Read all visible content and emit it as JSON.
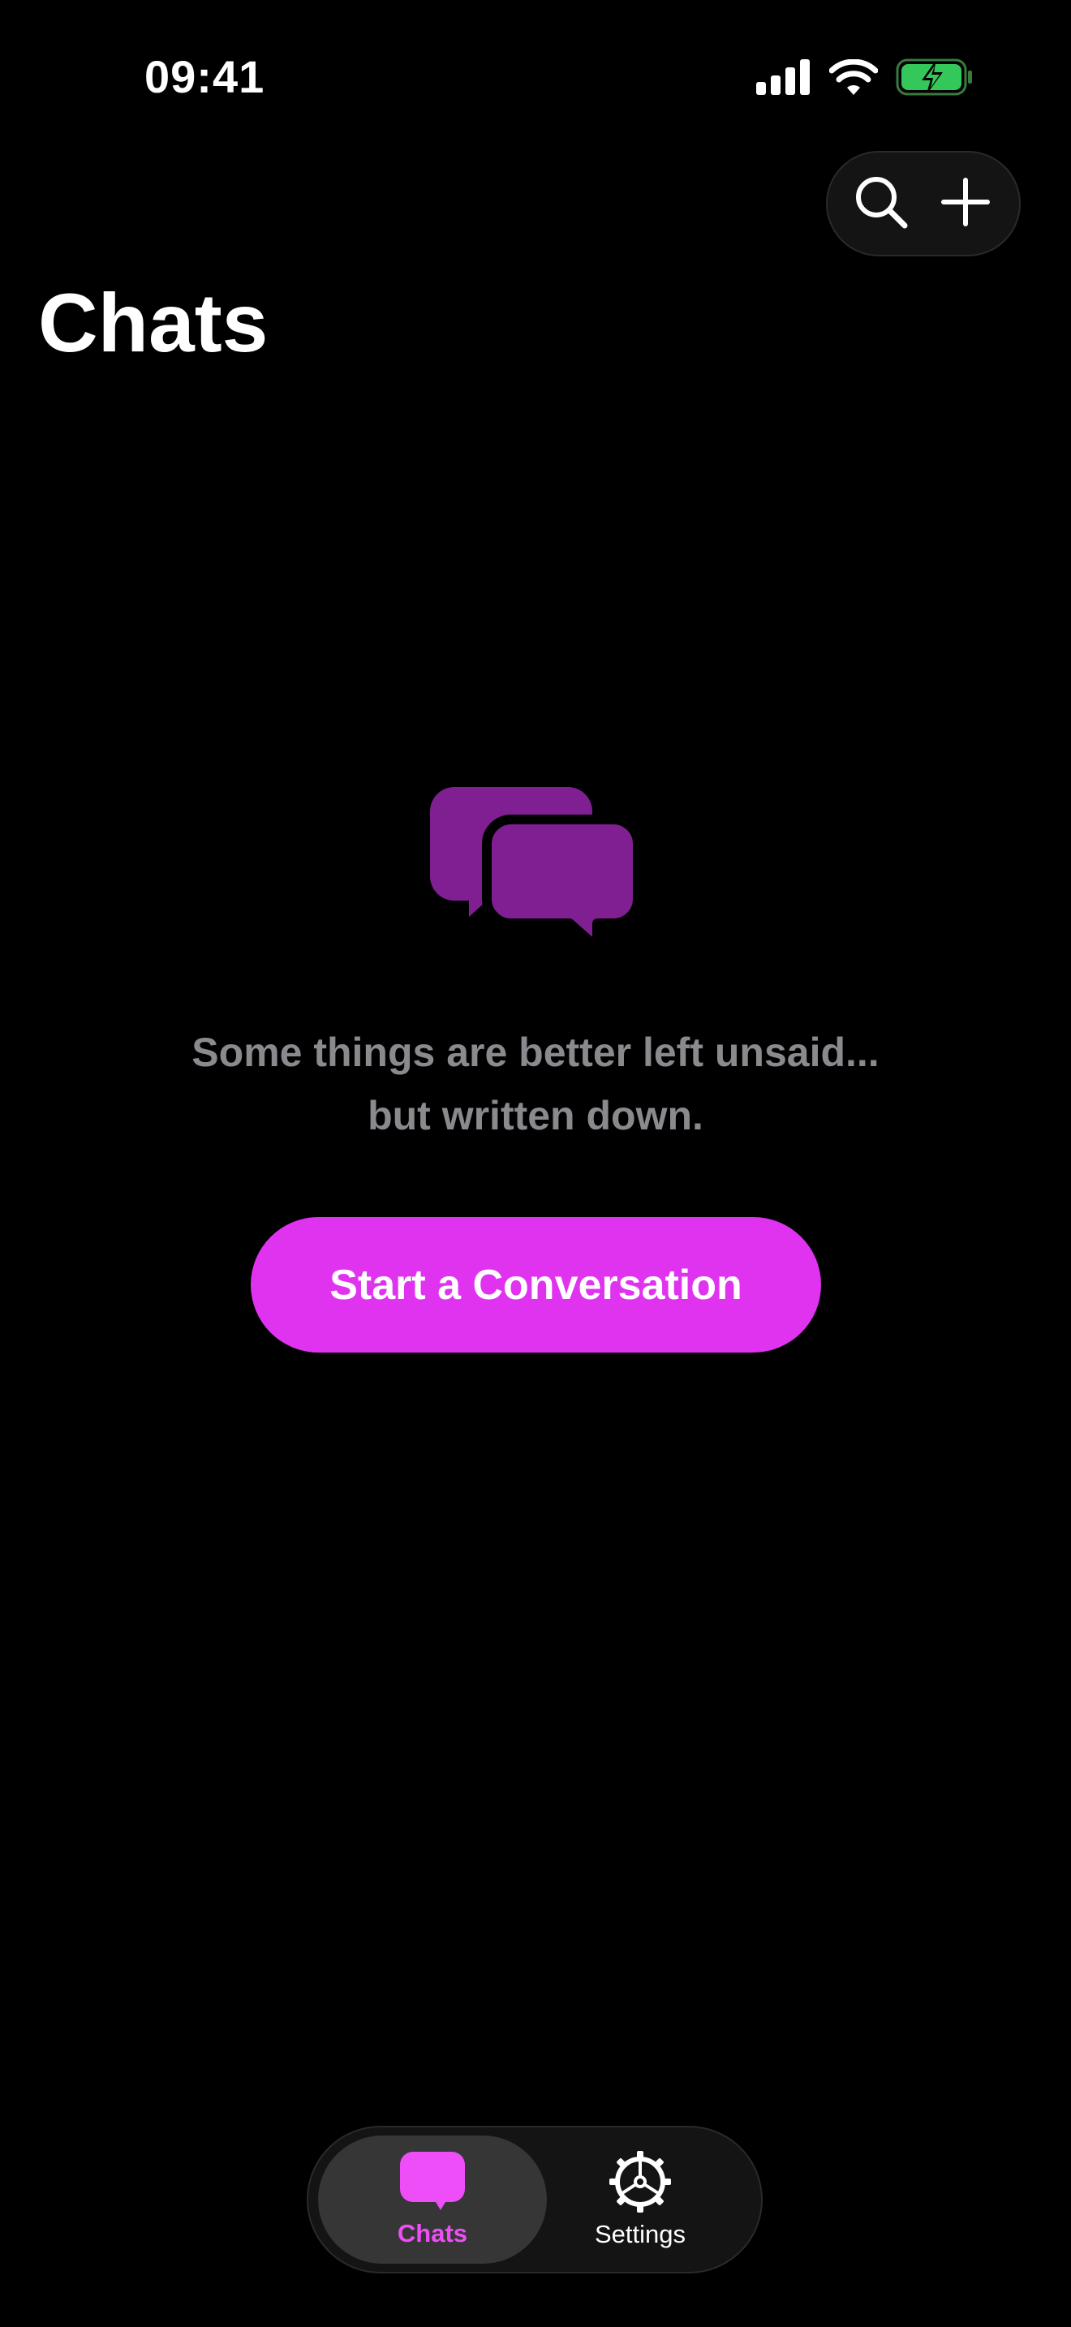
{
  "status_bar": {
    "time": "09:41",
    "icons": [
      "cellular-signal-icon",
      "wifi-icon",
      "battery-charging-icon"
    ],
    "battery_color": "#34c759"
  },
  "header": {
    "title": "Chats",
    "actions": [
      {
        "name": "search",
        "icon": "search-icon"
      },
      {
        "name": "new-chat",
        "icon": "plus-icon"
      }
    ]
  },
  "empty_state": {
    "icon": "chat-bubbles-icon",
    "icon_color": "#7f1f92",
    "message_line1": "Some things are better left unsaid...",
    "message_line2": "but written down.",
    "button_label": "Start a Conversation"
  },
  "tab_bar": {
    "tabs": [
      {
        "label": "Chats",
        "icon": "chat-bubble-icon",
        "selected": true
      },
      {
        "label": "Settings",
        "icon": "gear-icon",
        "selected": false
      }
    ]
  },
  "colors": {
    "accent": "#e033f0",
    "accent_tab": "#ee4ef8",
    "background": "#000000",
    "secondary_text": "#8a8a8e"
  }
}
